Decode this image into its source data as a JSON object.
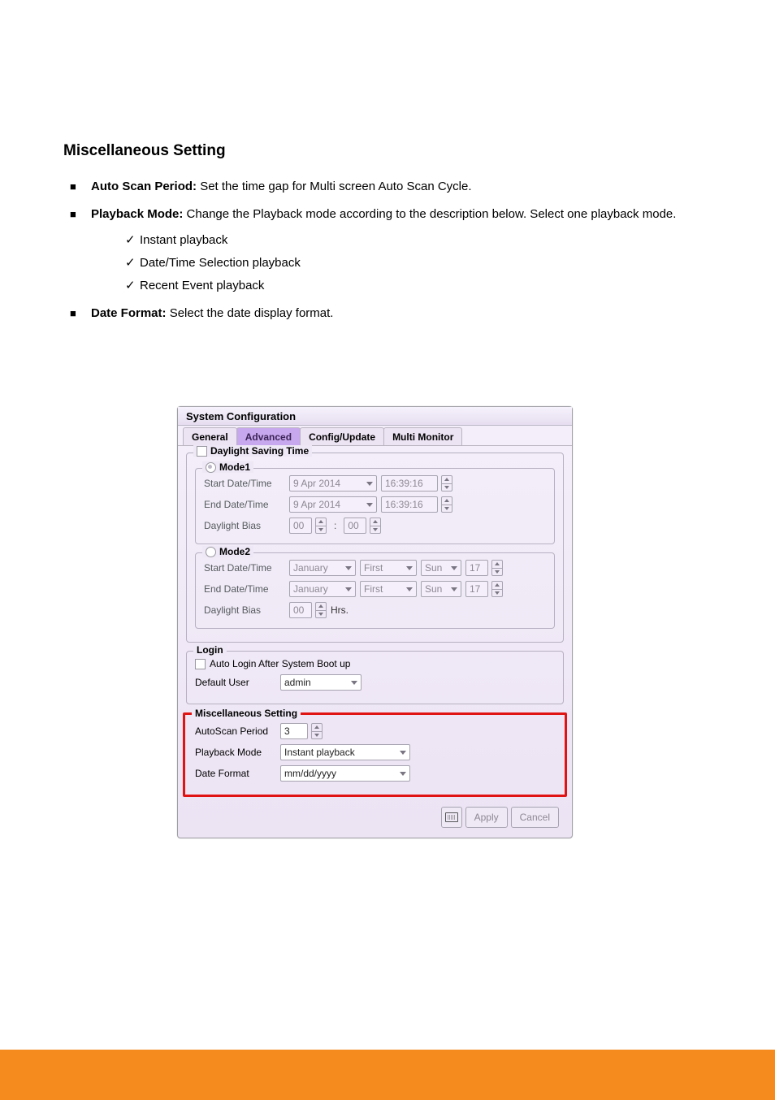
{
  "section_title": "Miscellaneous Setting",
  "bullets": {
    "autoscan": {
      "label": "Auto Scan Period:",
      "desc": "Set the time gap for Multi screen Auto Scan Cycle."
    },
    "playback": {
      "label": "Playback Mode:",
      "desc": "Change the Playback mode according to the description below. Select one playback mode.",
      "items": [
        "Instant playback",
        "Date/Time Selection playback",
        "Recent Event playback"
      ]
    },
    "dateformat": {
      "label": "Date Format:",
      "desc": "Select the date display format."
    }
  },
  "dialog": {
    "title": "System Configuration",
    "tabs": [
      "General",
      "Advanced",
      "Config/Update",
      "Multi Monitor"
    ],
    "active_tab": 1,
    "dst": {
      "title": "Daylight Saving Time",
      "mode1": {
        "title": "Mode1",
        "start_label": "Start Date/Time",
        "end_label": "End Date/Time",
        "bias_label": "Daylight Bias",
        "start_date": "9 Apr 2014",
        "start_time": "16:39:16",
        "end_date": "9 Apr 2014",
        "end_time": "16:39:16",
        "bias_h": "00",
        "bias_m": "00",
        "bias_sep": ":"
      },
      "mode2": {
        "title": "Mode2",
        "start_label": "Start Date/Time",
        "end_label": "End Date/Time",
        "bias_label": "Daylight Bias",
        "start_month": "January",
        "start_ord": "First",
        "start_dow": "Sun",
        "start_hr": "17",
        "end_month": "January",
        "end_ord": "First",
        "end_dow": "Sun",
        "end_hr": "17",
        "bias_h": "00",
        "hrs_label": "Hrs."
      }
    },
    "login": {
      "title": "Login",
      "autologin_label": "Auto Login After System Boot up",
      "default_user_label": "Default User",
      "default_user_value": "admin"
    },
    "misc": {
      "title": "Miscellaneous Setting",
      "autoscan_label": "AutoScan Period",
      "autoscan_value": "3",
      "playback_label": "Playback Mode",
      "playback_value": "Instant playback",
      "dateformat_label": "Date Format",
      "dateformat_value": "mm/dd/yyyy"
    },
    "buttons": {
      "apply": "Apply",
      "cancel": "Cancel"
    }
  }
}
